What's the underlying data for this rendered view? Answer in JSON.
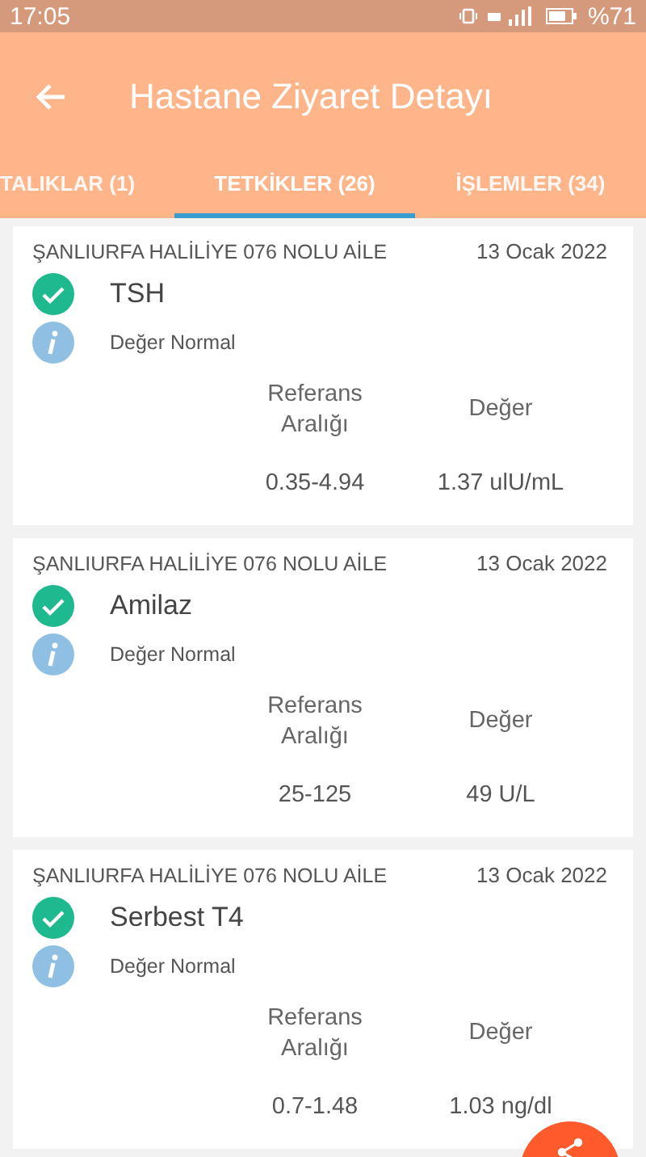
{
  "status_bar": {
    "time": "17:05",
    "battery": "%71"
  },
  "toolbar": {
    "title": "Hastane Ziyaret Detayı"
  },
  "tabs": [
    {
      "label": "TALIKLAR (1)",
      "selected": false
    },
    {
      "label": "TETKİKLER (26)",
      "selected": true
    },
    {
      "label": "İŞLEMLER (34)",
      "selected": false
    }
  ],
  "results": [
    {
      "institution": "ŞANLIURFA HALİLİYE 076 NOLU AİLE",
      "date": "13 Ocak 2022",
      "test": "TSH",
      "checked": true,
      "note": "Değer Normal",
      "range_label": "Referans Aralığı",
      "value_label": "Değer",
      "range": "0.35-4.94",
      "value": "1.37 ulU/mL"
    },
    {
      "institution": "ŞANLIURFA HALİLİYE 076 NOLU AİLE",
      "date": "13 Ocak 2022",
      "test": "Amilaz",
      "checked": true,
      "note": "Değer Normal",
      "range_label": "Referans Aralığı",
      "value_label": "Değer",
      "range": "25-125",
      "value": "49 U/L"
    },
    {
      "institution": "ŞANLIURFA HALİLİYE 076 NOLU AİLE",
      "date": "13 Ocak 2022",
      "test": "Serbest T4",
      "checked": true,
      "note": "Değer Normal",
      "range_label": "Referans Aralığı",
      "value_label": "Değer",
      "range": "0.7-1.48",
      "value": "1.03 ng/dl"
    }
  ]
}
